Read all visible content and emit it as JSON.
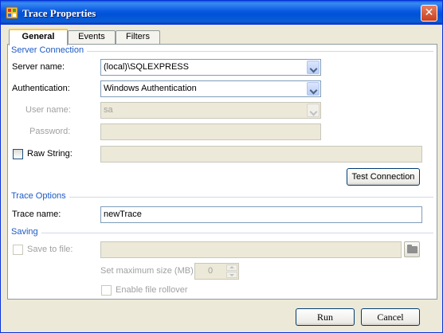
{
  "window": {
    "title": "Trace Properties",
    "close_glyph": "✕"
  },
  "tabs": [
    {
      "label": "General",
      "active": true
    },
    {
      "label": "Events",
      "active": false
    },
    {
      "label": "Filters",
      "active": false
    }
  ],
  "server_connection": {
    "section_label": "Server Connection",
    "server_name_label": "Server name:",
    "server_name_value": "(local)\\SQLEXPRESS",
    "authentication_label": "Authentication:",
    "authentication_value": "Windows Authentication",
    "user_name_label": "User name:",
    "user_name_value": "sa",
    "password_label": "Password:",
    "password_value": "",
    "raw_string_label": "Raw String:",
    "raw_string_value": "",
    "test_connection_label": "Test Connection"
  },
  "trace_options": {
    "section_label": "Trace Options",
    "trace_name_label": "Trace name:",
    "trace_name_value": "newTrace"
  },
  "saving": {
    "section_label": "Saving",
    "save_to_file_label": "Save to file:",
    "save_to_file_value": "",
    "max_size_label": "Set maximum size (MB)",
    "max_size_value": "0",
    "rollover_label": "Enable file rollover"
  },
  "buttons": {
    "run_label": "Run",
    "cancel_label": "Cancel"
  },
  "icons": {
    "app": "trace-app-icon",
    "close": "close-icon",
    "dropdown": "chevron-down-icon",
    "browse": "folder-icon",
    "spin": "spin-arrows-icon"
  },
  "colors": {
    "title_bar": "#0758e2",
    "section_label": "#1c5ac5",
    "dialog_bg": "#ece9d8"
  }
}
